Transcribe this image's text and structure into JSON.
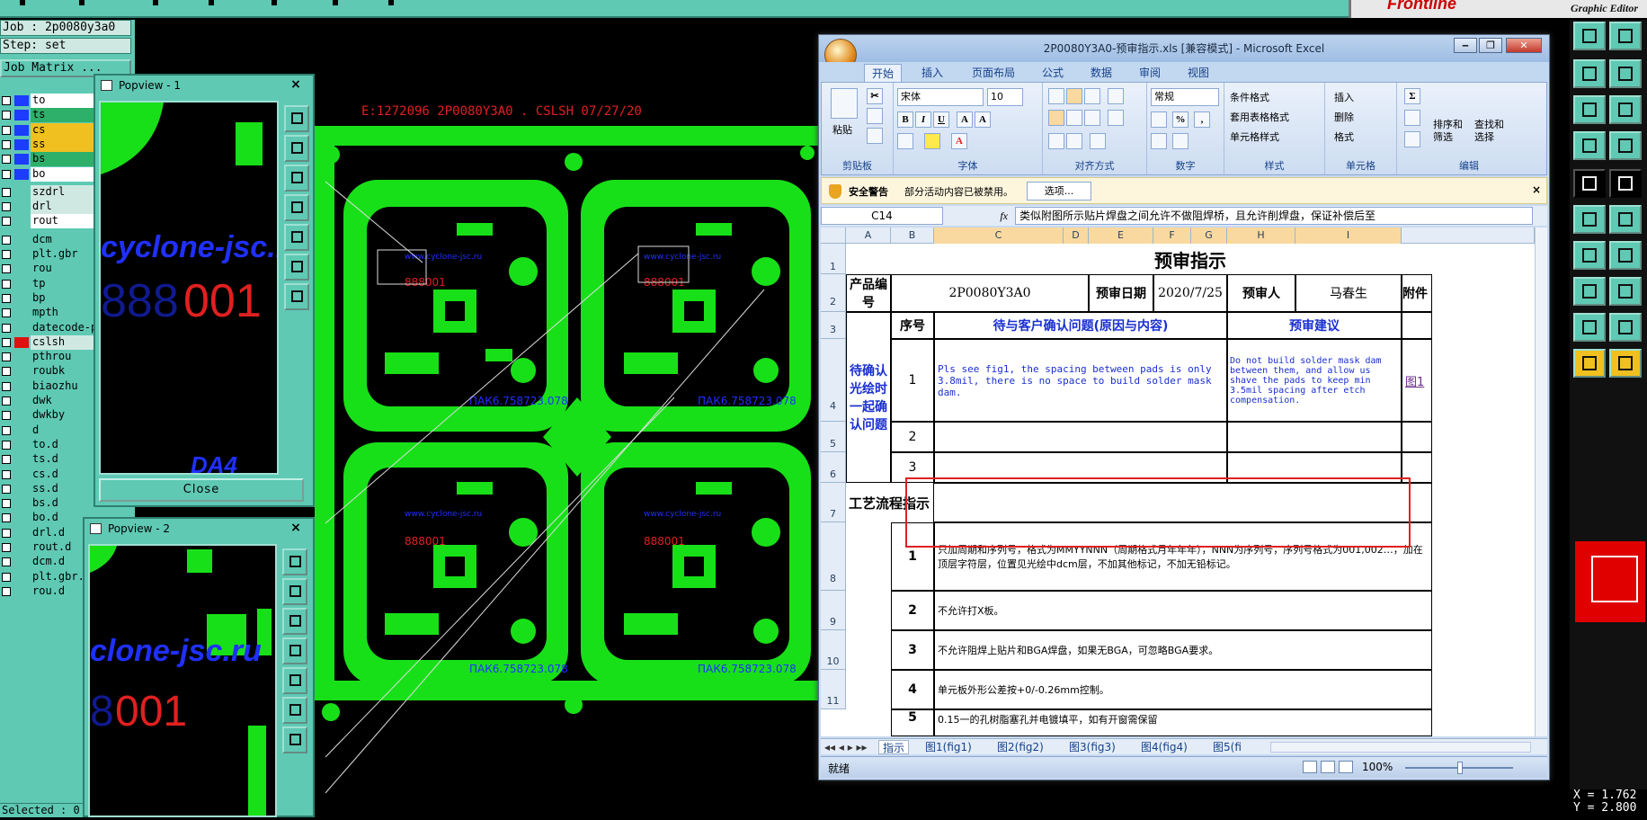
{
  "brand": {
    "name": "Frontline",
    "subtitle": "Graphic Editor"
  },
  "left_panel": {
    "job_label": "Job : 2p0080y3a0",
    "step_label": "Step: set",
    "job_matrix_label": "Job Matrix ...",
    "layers": [
      {
        "name": "to",
        "swatch": "#1c3cff",
        "bg": "#ffffff"
      },
      {
        "name": "ts",
        "swatch": "#1c3cff",
        "bg": "#2fb06a"
      },
      {
        "name": "cs",
        "swatch": "#1c3cff",
        "bg": "#f0c020"
      },
      {
        "name": "ss",
        "swatch": "#1c3cff",
        "bg": "#f0c020"
      },
      {
        "name": "bs",
        "swatch": "#1c3cff",
        "bg": "#2fb06a"
      },
      {
        "name": "bo",
        "swatch": "#1c3cff",
        "bg": "#ffffff"
      },
      {
        "name": "szdrl",
        "swatch": "",
        "bg": "#cfe9e2"
      },
      {
        "name": "drl",
        "swatch": "",
        "bg": "#cfe9e2"
      },
      {
        "name": "rout",
        "swatch": "",
        "bg": "#ffffff"
      },
      {
        "name": "dcm",
        "swatch": "",
        "bg": ""
      },
      {
        "name": "plt.gbr",
        "swatch": "",
        "bg": ""
      },
      {
        "name": "rou",
        "swatch": "",
        "bg": ""
      },
      {
        "name": "tp",
        "swatch": "",
        "bg": ""
      },
      {
        "name": "bp",
        "swatch": "",
        "bg": ""
      },
      {
        "name": "mpth",
        "swatch": "",
        "bg": ""
      },
      {
        "name": "datecode-p",
        "swatch": "",
        "bg": ""
      },
      {
        "name": "cslsh",
        "swatch": "#e01010",
        "bg": "#cfe9e2"
      },
      {
        "name": "pthrou",
        "swatch": "",
        "bg": ""
      },
      {
        "name": "roubk",
        "swatch": "",
        "bg": ""
      },
      {
        "name": "biaozhu",
        "swatch": "",
        "bg": ""
      },
      {
        "name": "dwk",
        "swatch": "",
        "bg": ""
      },
      {
        "name": "dwkby",
        "swatch": "",
        "bg": ""
      },
      {
        "name": "d",
        "swatch": "",
        "bg": ""
      },
      {
        "name": "to.d",
        "swatch": "",
        "bg": ""
      },
      {
        "name": "ts.d",
        "swatch": "",
        "bg": ""
      },
      {
        "name": "cs.d",
        "swatch": "",
        "bg": ""
      },
      {
        "name": "ss.d",
        "swatch": "",
        "bg": ""
      },
      {
        "name": "bs.d",
        "swatch": "",
        "bg": ""
      },
      {
        "name": "bo.d",
        "swatch": "",
        "bg": ""
      },
      {
        "name": "drl.d",
        "swatch": "",
        "bg": ""
      },
      {
        "name": "rout.d",
        "swatch": "",
        "bg": ""
      },
      {
        "name": "dcm.d",
        "swatch": "",
        "bg": ""
      },
      {
        "name": "plt.gbr.d",
        "swatch": "",
        "bg": ""
      },
      {
        "name": "rou.d",
        "swatch": "",
        "bg": ""
      }
    ],
    "selected_label": "Selected : 0"
  },
  "canvas": {
    "header_text": "E:1272096 2P0080Y3A0 . CSLSH 07/27/20",
    "board_label": "ПАК6.758723.078",
    "url_label": "www.cyclone-jsc.ru",
    "serial_label": "888001"
  },
  "popview1": {
    "title": "Popview - 1",
    "logo_text": "cyclone-jsc.ru",
    "code_dim": "888",
    "code_red": "001",
    "bottom_text": "DA4",
    "close_label": "Close"
  },
  "popview2": {
    "title": "Popview - 2",
    "logo_text": "clone-jsc.ru",
    "code_dim": "8",
    "code_red": "001"
  },
  "excel": {
    "title": "2P0080Y3A0-预审指示.xls  [兼容模式] - Microsoft Excel",
    "tabs": [
      "开始",
      "插入",
      "页面布局",
      "公式",
      "数据",
      "审阅",
      "视图"
    ],
    "ribbon": {
      "clipboard": {
        "label": "剪贴板",
        "paste": "粘贴"
      },
      "font": {
        "label": "字体",
        "name": "宋体",
        "size": "10",
        "bold": "B",
        "italic": "I",
        "underline": "U"
      },
      "align": {
        "label": "对齐方式"
      },
      "number": {
        "label": "数字",
        "format": "常规"
      },
      "styles": {
        "label": "样式",
        "cond": "条件格式",
        "table": "套用表格格式",
        "cell": "单元格样式"
      },
      "cells": {
        "label": "单元格",
        "insert": "插入",
        "delete": "删除",
        "format": "格式"
      },
      "edit": {
        "label": "编辑",
        "sort": "排序和\n筛选",
        "find": "查找和\n选择"
      }
    },
    "security": {
      "title": "安全警告",
      "message": "部分活动内容已被禁用。",
      "options": "选项..."
    },
    "namebox": "C14",
    "fx": "fx",
    "formula": "类似附图所示贴片焊盘之间允许不做阻焊桥，且允许削焊盘，保证补偿后至",
    "columns": [
      "A",
      "B",
      "C",
      "D",
      "E",
      "F",
      "G",
      "H",
      "I"
    ],
    "rows": [
      "1",
      "2",
      "3",
      "4",
      "5",
      "6",
      "7",
      "8",
      "9",
      "10",
      "11"
    ],
    "sheet": {
      "title": "预审指示",
      "product_label": "产品编号",
      "product_value": "2P0080Y3A0",
      "date_label": "预审日期",
      "date_value": "2020/7/25",
      "reviewer_label": "预审人",
      "reviewer_value": "马春生",
      "attach_label": "附件",
      "seq_header": "序号",
      "issue_header": "待与客户确认问题(原因与内容)",
      "suggest_header": "预审建议",
      "section1": "待确认光绘时一起确认问题",
      "q1_no": "1",
      "q1_issue": "Pls see fig1, the spacing between pads is only 3.8mil, there is no space to build solder mask dam.",
      "q1_suggest": "Do not build solder mask dam between them, and allow us shave the pads to keep min 3.5mil spacing after etch compensation.",
      "q1_link": "图1",
      "q2_no": "2",
      "q3_no": "3",
      "section2": "工艺流程指示",
      "p1_no": "1",
      "p1_text": "只加周期和序列号，格式为MMYYNNN（周期格式月年年年），NNN为序列号，序列号格式为001,002…，加在顶层字符层，位置见光绘中dcm层，不加其他标记，不加无铅标记。",
      "p2_no": "2",
      "p2_text": "不允许打X板。",
      "p3_no": "3",
      "p3_text": "不允许阻焊上贴片和BGA焊盘，如果无BGA，可忽略BGA要求。",
      "p4_no": "4",
      "p4_text": "单元板外形公差按+0/-0.26mm控制。",
      "p5_no": "5",
      "p5_text": "0.15一的孔树脂塞孔并电镀填平，如有开窗需保留"
    },
    "sheet_tabs": [
      "指示",
      "图1(fig1)",
      "图2(fig2)",
      "图3(fig3)",
      "图4(fig4)",
      "图5(fi"
    ],
    "status": "就绪",
    "zoom": "100%"
  },
  "coords": {
    "x": "X = 1.762",
    "y": "Y = 2.800"
  }
}
